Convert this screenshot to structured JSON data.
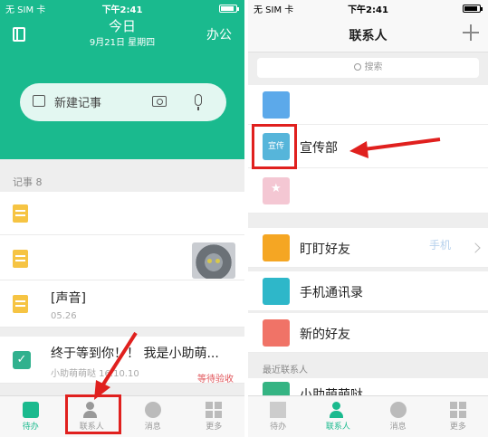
{
  "left": {
    "status": {
      "carrier": "无 SIM 卡",
      "time": "下午2:41"
    },
    "header": {
      "title": "今日",
      "date": "9月21日 星期四",
      "office": "办公"
    },
    "voice_input": {
      "text": "新建记事"
    },
    "section_label": "记事 8",
    "notes": [
      {
        "title": "[声音]",
        "sub": "05.26"
      },
      {
        "title": "终于等到你！！ 我是小助萌...",
        "sub": "小助萌萌哒  16.10.10",
        "status": "等待验收"
      }
    ],
    "tabs": [
      "待办",
      "联系人",
      "消息",
      "更多"
    ]
  },
  "right": {
    "status": {
      "carrier": "无 SIM 卡",
      "time": "下午2:41"
    },
    "nav": {
      "title": "联系人"
    },
    "search": {
      "placeholder": "搜索"
    },
    "group": {
      "tile_text": "宣传",
      "label": "宣传部"
    },
    "items": [
      "盯盯好友",
      "手机通讯录",
      "新的好友"
    ],
    "recent_label": "最近联系人",
    "recent": [
      {
        "label": "小助萌萌哒"
      }
    ],
    "tabs": [
      "待办",
      "联系人",
      "消息",
      "更多"
    ],
    "watermark": "手机"
  },
  "colors": {
    "accent": "#1aba8e",
    "highlight": "#e0201e",
    "status_red": "#e0555a"
  }
}
